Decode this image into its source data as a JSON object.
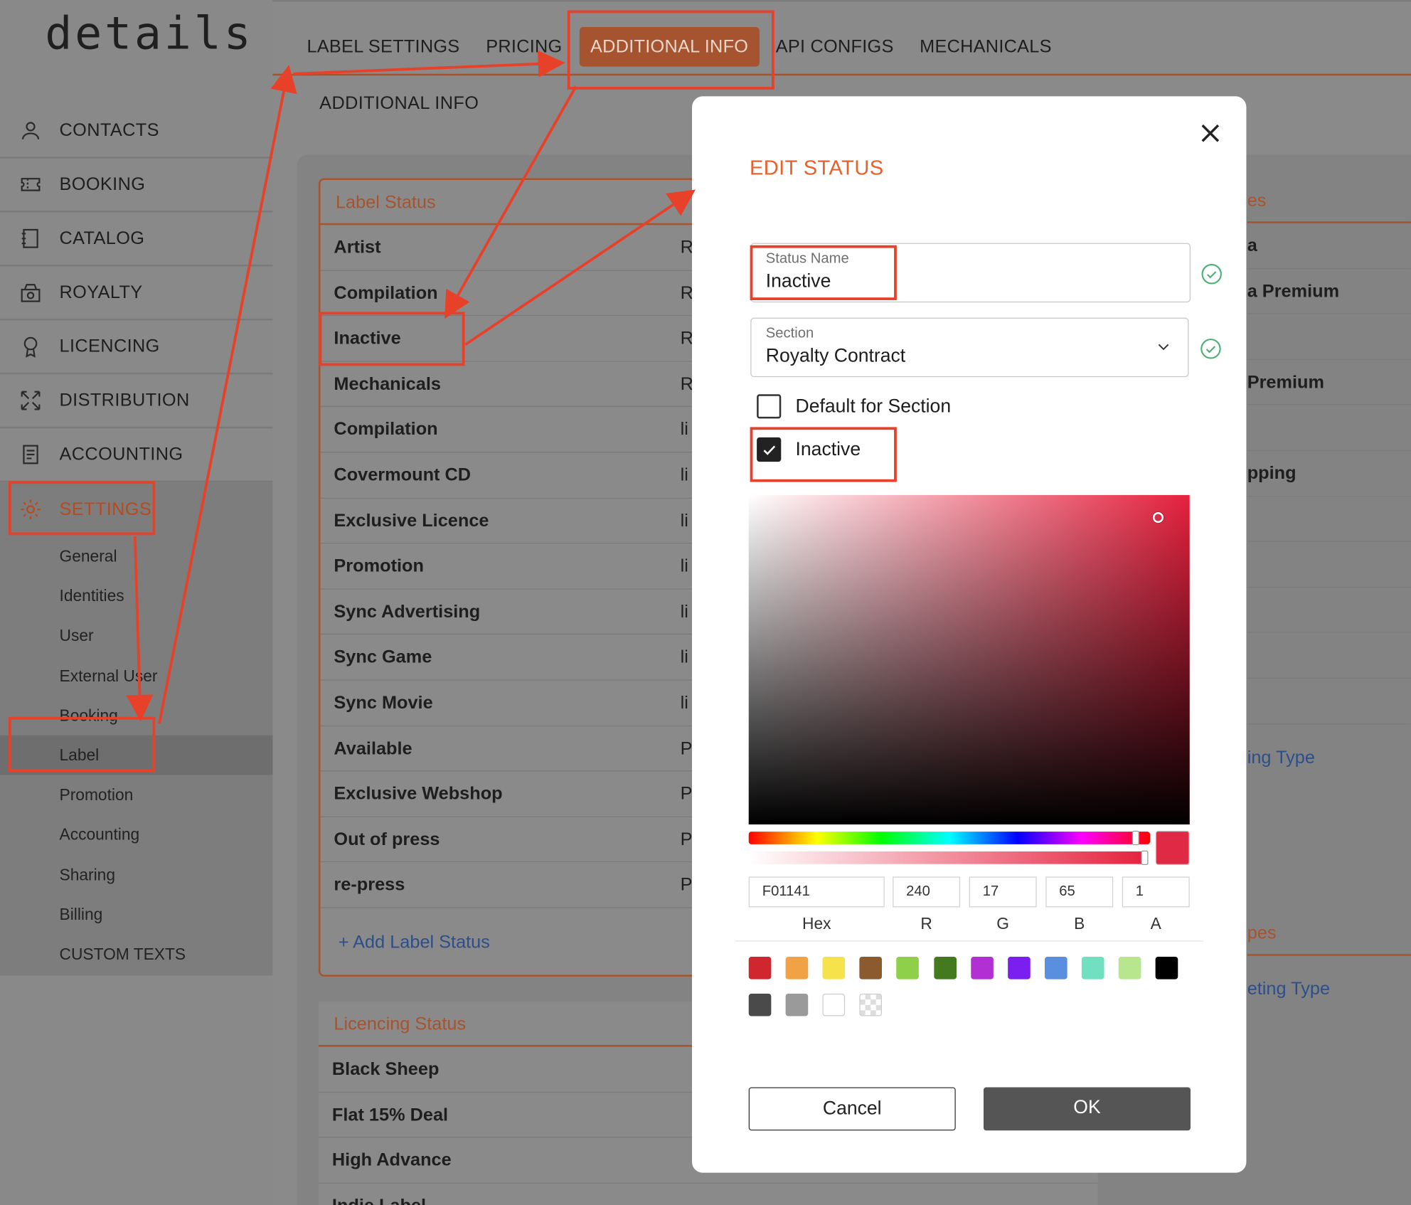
{
  "app": {
    "logo": "details"
  },
  "sidebar": {
    "items": [
      {
        "label": "CONTACTS",
        "icon": "person-icon"
      },
      {
        "label": "BOOKING",
        "icon": "ticket-icon"
      },
      {
        "label": "CATALOG",
        "icon": "catalog-icon"
      },
      {
        "label": "ROYALTY",
        "icon": "cash-register-icon"
      },
      {
        "label": "LICENCING",
        "icon": "award-icon"
      },
      {
        "label": "DISTRIBUTION",
        "icon": "expand-arrows-icon"
      },
      {
        "label": "ACCOUNTING",
        "icon": "document-icon"
      },
      {
        "label": "SETTINGS",
        "icon": "gear-icon"
      }
    ],
    "settings_sub": [
      "General",
      "Identities",
      "User",
      "External User",
      "Booking",
      "Label",
      "Promotion",
      "Accounting",
      "Sharing",
      "Billing",
      "CUSTOM TEXTS"
    ]
  },
  "tabs": [
    "LABEL SETTINGS",
    "PRICING",
    "ADDITIONAL INFO",
    "API CONFIGS",
    "MECHANICALS"
  ],
  "subtitle": "ADDITIONAL INFO",
  "label_status": {
    "title": "Label Status",
    "rows": [
      {
        "name": "Artist",
        "val": "R"
      },
      {
        "name": "Compilation",
        "val": "R"
      },
      {
        "name": "Inactive",
        "val": "R"
      },
      {
        "name": "Mechanicals",
        "val": "R"
      },
      {
        "name": "Compilation",
        "val": "li"
      },
      {
        "name": "Covermount CD",
        "val": "li"
      },
      {
        "name": "Exclusive Licence",
        "val": "li"
      },
      {
        "name": "Promotion",
        "val": "li"
      },
      {
        "name": "Sync Advertising",
        "val": "li"
      },
      {
        "name": "Sync Game",
        "val": "li"
      },
      {
        "name": "Sync Movie",
        "val": "li"
      },
      {
        "name": "Available",
        "val": "P"
      },
      {
        "name": "Exclusive Webshop",
        "val": "P"
      },
      {
        "name": "Out of press",
        "val": "P"
      },
      {
        "name": "re-press",
        "val": "P"
      }
    ],
    "add_label": "+ Add Label Status"
  },
  "licencing_status": {
    "title": "Licencing Status",
    "rows": [
      "Black Sheep",
      "Flat 15% Deal",
      "High Advance",
      "Indie Label"
    ]
  },
  "right_col": {
    "head1": "es",
    "rows1": [
      "a",
      "a Premium",
      "",
      "Premium",
      "",
      "pping",
      "",
      "",
      "",
      "",
      ""
    ],
    "link1": "ing Type",
    "head2": "pes",
    "link2": "eting Type"
  },
  "modal": {
    "title": "EDIT STATUS",
    "status_name_label": "Status Name",
    "status_name_value": "Inactive",
    "section_label": "Section",
    "section_value": "Royalty Contract",
    "default_label": "Default for Section",
    "default_checked": false,
    "inactive_label": "Inactive",
    "inactive_checked": true,
    "color": {
      "hex": "F01141",
      "r": "240",
      "g": "17",
      "b": "65",
      "a": "1"
    },
    "labels": {
      "hex": "Hex",
      "r": "R",
      "g": "G",
      "b": "B",
      "a": "A"
    },
    "swatches": [
      "#d0262e",
      "#f0a245",
      "#f6e24a",
      "#8b5a2e",
      "#8fd04a",
      "#437a1f",
      "#b12fd3",
      "#7a1ff0",
      "#5a8fe0",
      "#70e0c0",
      "#b8e68f",
      "#000000",
      "#4a4a4a",
      "#9a9a9a",
      "#ffffff",
      "transparent"
    ],
    "cancel_label": "Cancel",
    "ok_label": "OK"
  },
  "colors": {
    "accent": "#e8612a",
    "brand_dark": "#a6542f",
    "annotation": "#e8412a"
  }
}
